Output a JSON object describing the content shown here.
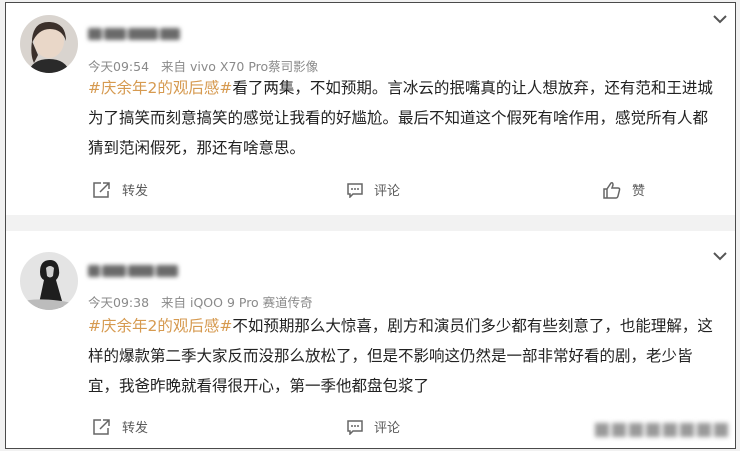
{
  "posts": [
    {
      "meta": {
        "time": "今天09:54",
        "source": "来自 vivo X70 Pro蔡司影像"
      },
      "hashtag": "#庆余年2的观后感#",
      "text": "看了两集，不如预期。言冰云的抿嘴真的让人想放弃，还有范和王进城为了搞笑而刻意搞笑的感觉让我看的好尴尬。最后不知道这个假死有啥作用，感觉所有人都猜到范闲假死，那还有啥意思。",
      "actions": {
        "repost": "转发",
        "comment": "评论",
        "like": "赞"
      }
    },
    {
      "meta": {
        "time": "今天09:38",
        "source": "来自 iQOO 9 Pro 赛道传奇"
      },
      "hashtag": "#庆余年2的观后感#",
      "text": "不如预期那么大惊喜，剧方和演员们多少都有些刻意了，也能理解，这样的爆款第二季大家反而没那么放松了，但是不影响这仍然是一部非常好看的剧，老少皆宜，我爸昨晚就看得很开心，第一季他都盘包浆了",
      "actions": {
        "repost": "转发",
        "comment": "评论"
      }
    }
  ],
  "colors": {
    "hashtag": "#d69a50",
    "text": "#222222",
    "meta": "#8a8a8a",
    "action": "#5a5a5a"
  },
  "icons": [
    "avatar",
    "chevron-down-icon",
    "repost-icon",
    "comment-icon",
    "like-icon"
  ]
}
